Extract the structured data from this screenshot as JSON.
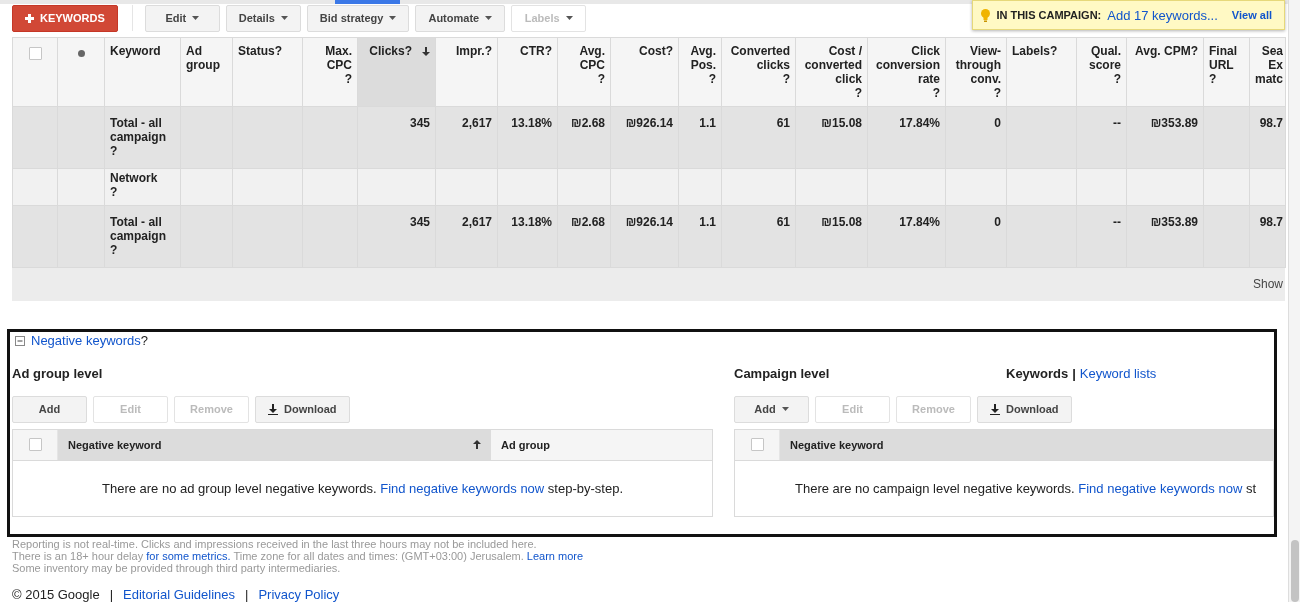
{
  "toolbar": {
    "buttons": [
      {
        "label": "KEYWORDS",
        "kind": "primary",
        "disabled": false
      },
      {
        "label": "Edit",
        "kind": "menu",
        "disabled": false
      },
      {
        "label": "Details",
        "kind": "menu",
        "disabled": false
      },
      {
        "label": "Bid strategy",
        "kind": "menu",
        "disabled": false
      },
      {
        "label": "Automate",
        "kind": "menu",
        "disabled": false
      },
      {
        "label": "Labels",
        "kind": "menu",
        "disabled": true
      }
    ]
  },
  "tip": {
    "heading": "IN THIS CAMPAIGN:",
    "link": "Add 17 keywords...",
    "action": "View all"
  },
  "keywords_table": {
    "ascending": false,
    "columns": [
      {
        "kind": "checkbox",
        "checked": false
      },
      {
        "kind": "status"
      },
      {
        "kind": "text",
        "label": "Keyword",
        "sorted": false
      },
      {
        "kind": "text",
        "label": "Ad group",
        "sorted": false
      },
      {
        "kind": "text",
        "label": "Status",
        "help": "?",
        "sorted": false
      },
      {
        "kind": "setting",
        "label": "Max. CPC",
        "help": "?",
        "sorted": false
      },
      {
        "kind": "number",
        "label": "Clicks",
        "help": "?",
        "sorted": true
      },
      {
        "kind": "number",
        "label": "Impr.",
        "help": "?",
        "sorted": false
      },
      {
        "kind": "number",
        "label": "CTR",
        "help": "?",
        "sorted": false
      },
      {
        "kind": "number",
        "label": "Avg. CPC",
        "help": "?",
        "sorted": false
      },
      {
        "kind": "number",
        "label": "Cost",
        "help": "?",
        "sorted": false
      },
      {
        "kind": "number",
        "label": "Avg. Pos.",
        "help": "?",
        "sorted": false
      },
      {
        "kind": "number",
        "label": "Converted clicks",
        "help": "?",
        "sorted": false
      },
      {
        "kind": "number",
        "label": "Cost / converted click",
        "help": "?",
        "sorted": false
      },
      {
        "kind": "number",
        "label": "Click conversion rate",
        "help": "?",
        "sorted": false
      },
      {
        "kind": "number",
        "label": "View-through conv.",
        "help": "?",
        "sorted": false
      },
      {
        "kind": "text",
        "label": "Labels",
        "help": "?",
        "sorted": false
      },
      {
        "kind": "number",
        "label": "Qual. score",
        "help": "?",
        "sorted": false
      },
      {
        "kind": "number",
        "label": "Avg. CPM",
        "help": "?",
        "sorted": false
      },
      {
        "kind": "text",
        "label": "Final URL",
        "help": "?",
        "sorted": false
      },
      {
        "kind": "number",
        "label": "Sea Ex matc",
        "sorted": false
      }
    ],
    "rows": [
      {
        "kind": "total",
        "label": "Total - all campaign",
        "help": "?",
        "values": [
          "345",
          "2,617",
          "13.18%",
          "₪2.68",
          "₪926.14",
          "1.1",
          "61",
          "₪15.08",
          "17.84%",
          "0",
          "--",
          "₪353.89",
          "98.7"
        ]
      },
      {
        "kind": "row",
        "label": "Network",
        "help": "?"
      },
      {
        "kind": "total",
        "label": "Total - all campaign",
        "help": "?",
        "values": [
          "345",
          "2,617",
          "13.18%",
          "₪2.68",
          "₪926.14",
          "1.1",
          "61",
          "₪15.08",
          "17.84%",
          "0",
          "--",
          "₪353.89",
          "98.7"
        ]
      }
    ],
    "footer": "Show"
  },
  "negative_keywords": {
    "title": "Negative keywords",
    "help": "?",
    "expanded": true,
    "panels": [
      {
        "title": "Ad group level",
        "buttons": [
          {
            "label": "Add",
            "kind": "plain",
            "disabled": false
          },
          {
            "label": "Edit",
            "kind": "plain",
            "disabled": true
          },
          {
            "label": "Remove",
            "kind": "plain",
            "disabled": true
          },
          {
            "label": "Download",
            "kind": "download",
            "disabled": false
          }
        ],
        "ascending": true,
        "columns": [
          {
            "kind": "checkbox",
            "checked": false
          },
          {
            "kind": "text",
            "label": "Negative keyword",
            "sorted": true
          },
          {
            "kind": "text",
            "label": "Ad group",
            "sorted": false
          }
        ],
        "message": {
          "text": "There are no ad group level negative keywords. ",
          "link": "Find negative keywords now",
          "after": " step-by-step."
        }
      },
      {
        "title": "Campaign level",
        "tabs": [
          {
            "label": "Keywords",
            "selected": true
          },
          {
            "label": "Keyword lists",
            "selected": false
          }
        ],
        "tab_separator": "|",
        "buttons": [
          {
            "label": "Add",
            "kind": "menu",
            "disabled": false
          },
          {
            "label": "Edit",
            "kind": "plain",
            "disabled": true
          },
          {
            "label": "Remove",
            "kind": "plain",
            "disabled": true
          },
          {
            "label": "Download",
            "kind": "download",
            "disabled": false
          }
        ],
        "columns": [
          {
            "kind": "checkbox",
            "checked": false
          },
          {
            "kind": "text",
            "label": "Negative keyword",
            "sorted": true
          }
        ],
        "message": {
          "text": "There are no campaign level negative keywords. ",
          "link": "Find negative keywords now",
          "after": " st"
        }
      }
    ]
  },
  "notes": [
    [
      {
        "kind": "text",
        "text": "Reporting is not real-time. Clicks and impressions received in the last three hours may not be included here."
      }
    ],
    [
      {
        "kind": "text",
        "text": "There is an 18+ hour delay "
      },
      {
        "kind": "link",
        "text": "for some metrics."
      },
      {
        "kind": "text",
        "text": " Time zone for all dates and times: (GMT+03:00) Jerusalem. "
      },
      {
        "kind": "link",
        "text": "Learn more"
      }
    ],
    [
      {
        "kind": "text",
        "text": "Some inventory may be provided through third party intermediaries."
      }
    ]
  ],
  "copyright": [
    {
      "kind": "text",
      "text": "© 2015 Google"
    },
    {
      "kind": "separator",
      "text": "|"
    },
    {
      "kind": "link",
      "text": "Editorial Guidelines"
    },
    {
      "kind": "separator",
      "text": "|"
    },
    {
      "kind": "link",
      "text": "Privacy Policy"
    }
  ]
}
